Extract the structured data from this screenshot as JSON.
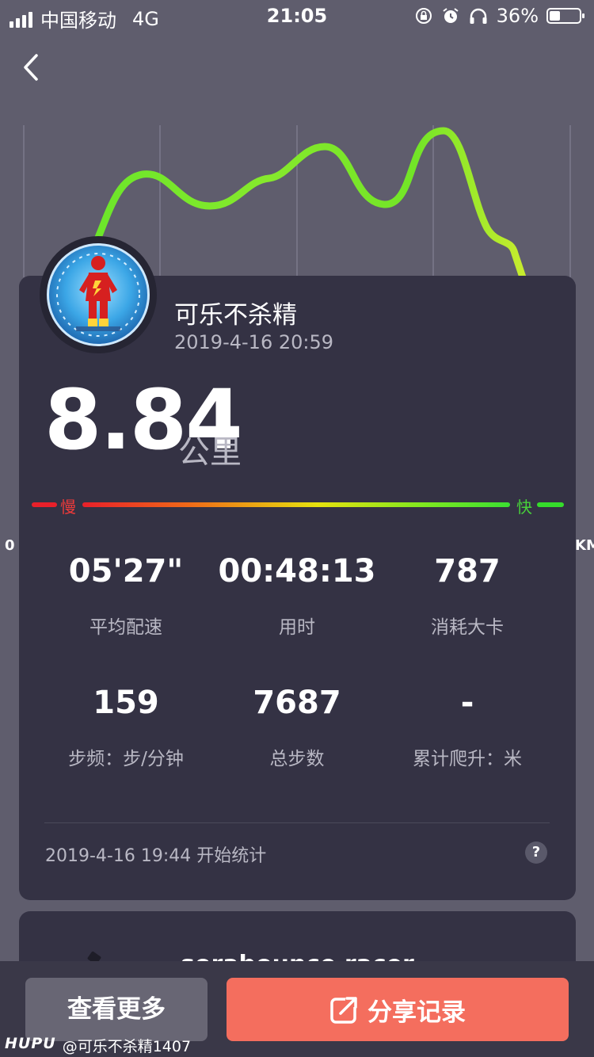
{
  "status_bar": {
    "carrier": "中国移动",
    "network": "4G",
    "time": "21:05",
    "battery": "36%",
    "battery_level": 0.36
  },
  "chart": {
    "x_start": "0",
    "x_end_fragment": "KM",
    "grid": true,
    "line_colors": [
      "#a3ef2e",
      "#3fe022"
    ]
  },
  "user": {
    "name": "可乐不杀精",
    "datetime": "2019-4-16 20:59"
  },
  "run": {
    "distance": "8.84",
    "unit": "公里",
    "speed_slow": "慢",
    "speed_fast": "快"
  },
  "stats": [
    {
      "value": "05'27\"",
      "label": "平均配速"
    },
    {
      "value": "00:48:13",
      "label": "用时"
    },
    {
      "value": "787",
      "label": "消耗大卡"
    },
    {
      "value": "159",
      "label": "步频：步/分钟"
    },
    {
      "value": "7687",
      "label": "总步数"
    },
    {
      "value": "-",
      "label": "累计爬升：米"
    }
  ],
  "footer": {
    "start_text": "2019-4-16 19:44 开始统计",
    "help": "?"
  },
  "card2": {
    "title_partial": "sorabounce racer"
  },
  "actions": {
    "more": "查看更多",
    "share": "分享记录"
  },
  "watermark": {
    "logo": "HUPU",
    "handle": "@可乐不杀精1407"
  },
  "colors": {
    "background": "#5f5d6d",
    "card": "#343244",
    "share_button": "#f46e5e",
    "more_button": "#686674"
  }
}
